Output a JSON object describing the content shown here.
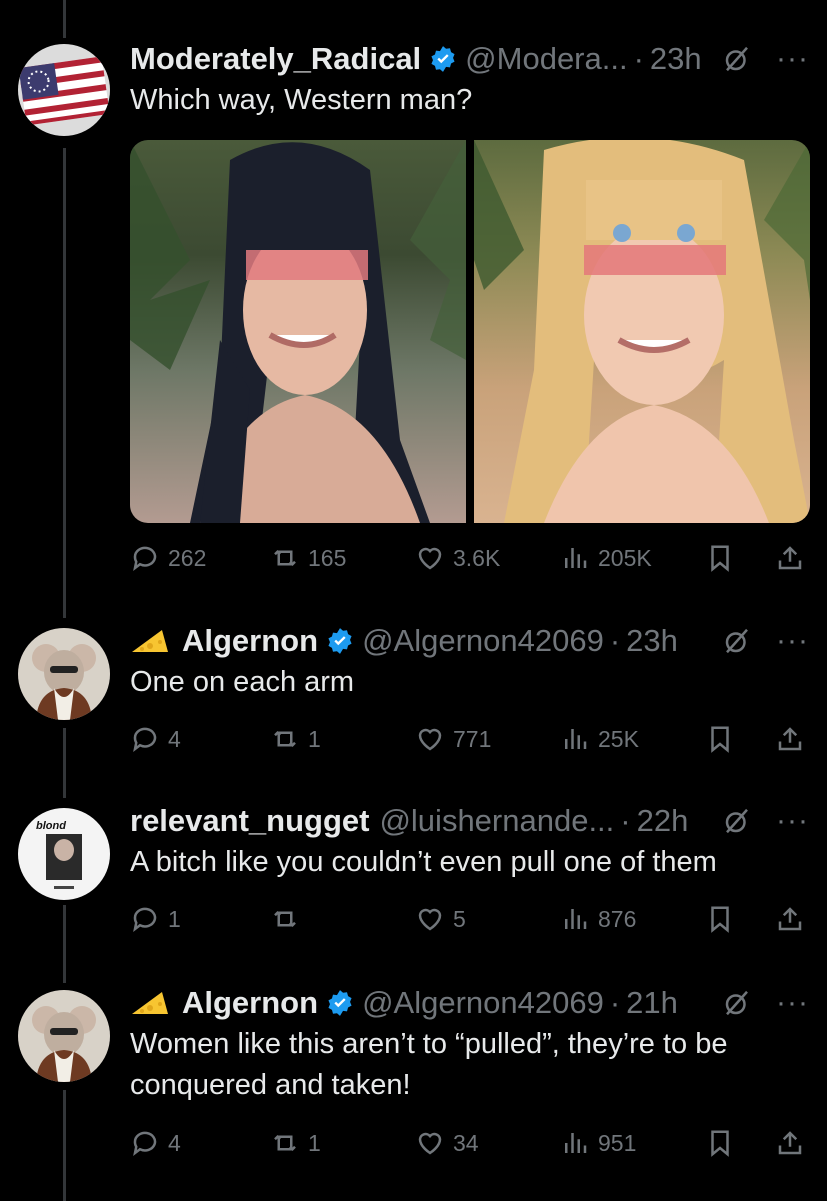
{
  "tweets": [
    {
      "name": "Moderately_Radical",
      "handle": "@Modera...",
      "dot": "·",
      "time": "23h",
      "text": "Which way, Western man?",
      "stats": {
        "replies": "262",
        "reposts": "165",
        "likes": "3.6K",
        "views": "205K"
      },
      "avatar": "flag-avatar",
      "media": [
        "dark-haired-woman-photo",
        "blonde-woman-photo"
      ]
    },
    {
      "emoji": "cheese-icon",
      "name": "Algernon",
      "handle": "@Algernon42069",
      "dot": "·",
      "time": "23h",
      "text": "One on each arm",
      "stats": {
        "replies": "4",
        "reposts": "1",
        "likes": "771",
        "views": "25K"
      },
      "avatar": "mouse-avatar"
    },
    {
      "name": "relevant_nugget",
      "handle": "@luishernande...",
      "dot": "·",
      "time": "22h",
      "text": "A bitch like you couldn’t even pull one of them",
      "stats": {
        "replies": "1",
        "reposts": "",
        "likes": "5",
        "views": "876"
      },
      "avatar": "blond-album-avatar",
      "avatar_text": "blond"
    },
    {
      "emoji": "cheese-icon",
      "name": "Algernon",
      "handle": "@Algernon42069",
      "dot": "·",
      "time": "21h",
      "text": "Women like this aren’t to “pulled”, they’re to be conquered and taken!",
      "stats": {
        "replies": "4",
        "reposts": "1",
        "likes": "34",
        "views": "951"
      },
      "avatar": "mouse-avatar"
    }
  ],
  "more_label": "···",
  "colors": {
    "background": "#000000",
    "text": "#e7e9ea",
    "muted": "#71767b",
    "verified": "#1d9bf0"
  }
}
